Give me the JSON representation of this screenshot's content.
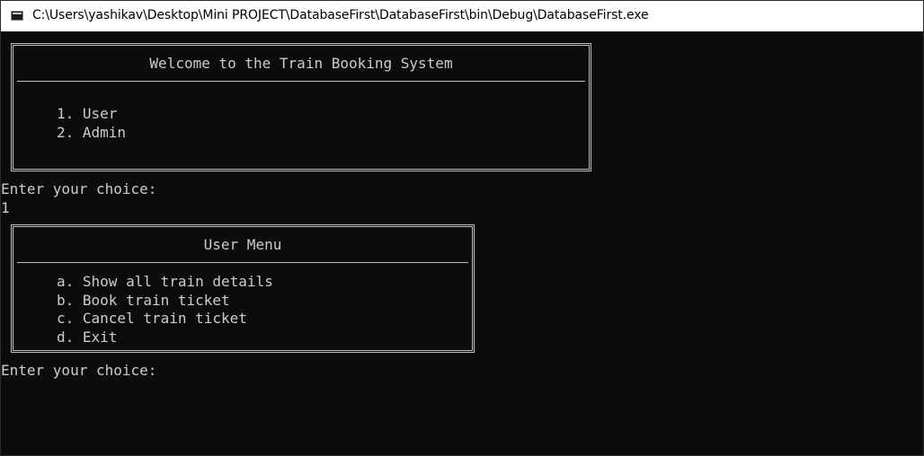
{
  "window": {
    "title": "C:\\Users\\yashikav\\Desktop\\Mini PROJECT\\DatabaseFirst\\DatabaseFirst\\bin\\Debug\\DatabaseFirst.exe",
    "icon": "console-app-icon"
  },
  "console": {
    "main_menu": {
      "title": "Welcome to the Train Booking System",
      "items": [
        "1. User",
        "2. Admin"
      ]
    },
    "prompt_1": "Enter your choice:",
    "input_1": "1",
    "user_menu": {
      "title": "User Menu",
      "items": [
        "a. Show all train details",
        "b. Book train ticket",
        "c. Cancel train ticket",
        "d. Exit"
      ]
    },
    "prompt_2": "Enter your choice:"
  },
  "colors": {
    "background": "#0c0c0c",
    "text": "#cccccc",
    "titlebar": "#ffffff"
  }
}
